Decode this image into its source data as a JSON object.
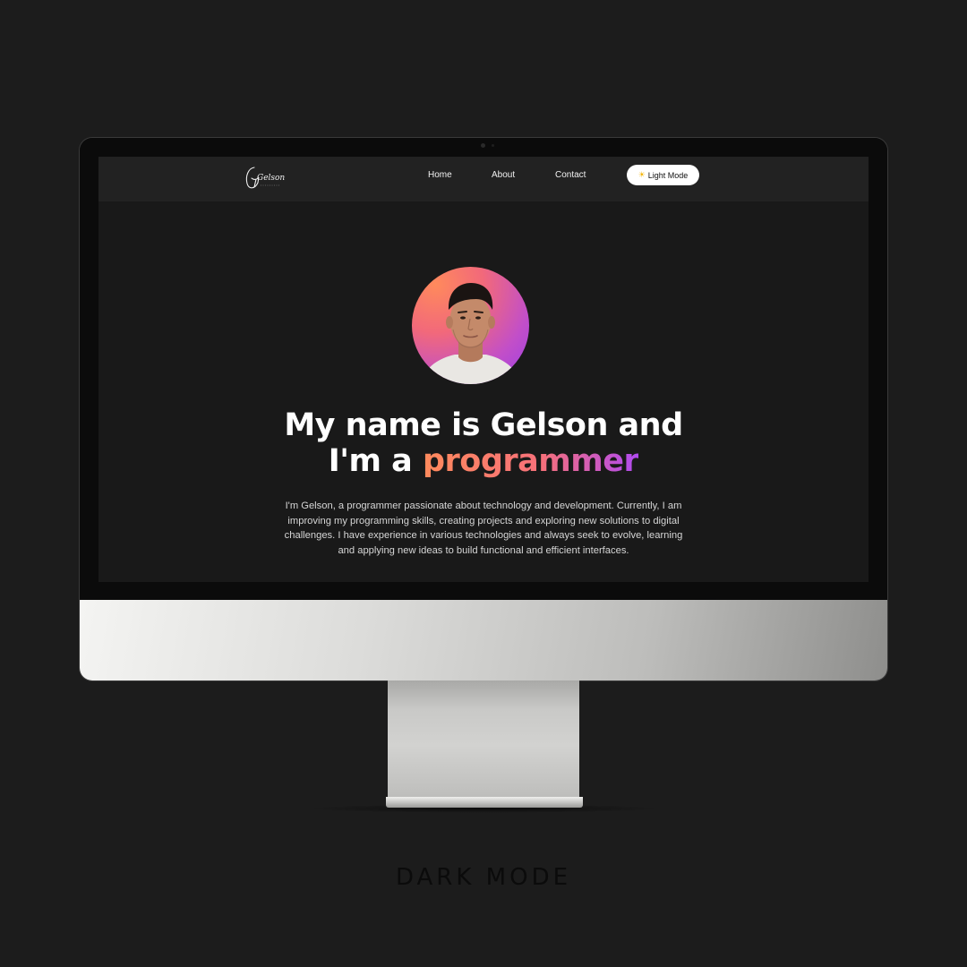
{
  "navbar": {
    "logo_text": "Gelson",
    "links": [
      "Home",
      "About",
      "Contact"
    ],
    "mode_toggle": {
      "icon": "sun-icon",
      "label": "Light Mode"
    }
  },
  "hero": {
    "avatar": "profile-photo",
    "headline_line1": "My name is Gelson and",
    "headline_line2_prefix": "I'm a ",
    "headline_line2_accent": "programmer",
    "bio": "I'm Gelson, a programmer passionate about technology and development. Currently, I am improving my programming skills, creating projects and exploring new solutions to digital challenges. I have experience in various technologies and always seek to evolve, learning and applying new ideas to build functional and efficient interfaces."
  },
  "caption": "DARK MODE",
  "colors": {
    "background": "#1c1c1c",
    "screen": "#191919",
    "navbar": "#222222",
    "accent_start": "#ff8a5c",
    "accent_end": "#b04af0"
  }
}
